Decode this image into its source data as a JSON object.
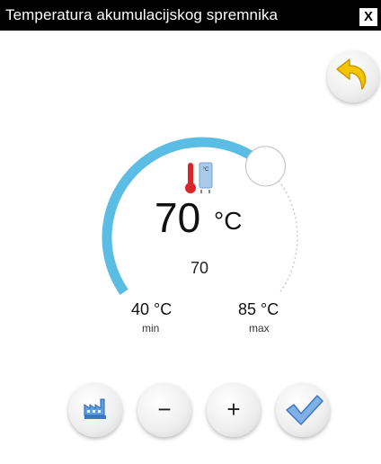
{
  "window": {
    "title": "Temperatura akumulacijskog spremnika",
    "close_label": "X"
  },
  "dial": {
    "current_temp": "70",
    "current_unit": "°C",
    "setpoint": "70",
    "min_value": "40 °C",
    "min_label": "min",
    "max_value": "85 °C",
    "max_label": "max",
    "min": 40,
    "max": 85,
    "value": 70,
    "thermo_badge": "°C"
  },
  "buttons": {
    "minus": "−",
    "plus": "+"
  },
  "icons": {
    "back": "undo-arrow-icon",
    "thermometer": "thermometer-tank-icon",
    "factory": "factory-icon",
    "confirm": "checkmark-icon"
  },
  "colors": {
    "arc": "#5bbde3",
    "arrow": "#f5c400",
    "check": "#6a9ed8",
    "thermo_red": "#d8262b"
  }
}
